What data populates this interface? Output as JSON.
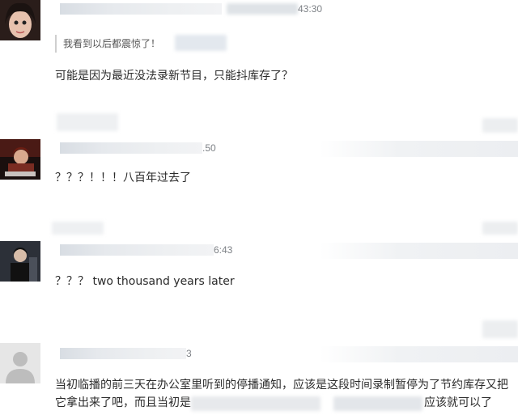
{
  "comments": [
    {
      "time_fragment": "43:30",
      "reply_quote": "我看到以后都震惊了！",
      "text": "可能是因为最近没法录新节目，只能抖库存了？"
    },
    {
      "time_fragment": ".50",
      "text": "？？？！！！八百年过去了"
    },
    {
      "time_fragment": "6:43",
      "text": "？？？ two thousand years later"
    },
    {
      "time_fragment": "3",
      "text_line1": "当初临播的前三天在办公室里听到的停播通知，应该是这段时间录制暂停为了节约库存又把",
      "text_line2_a": "它拿出来了吧，而且当初是",
      "text_line2_b": "应该就可以了"
    }
  ],
  "colors": {
    "meta_bar": "#d8dde3",
    "text": "#2b2b2b",
    "timestamp": "#7d8186"
  },
  "icons": [
    "user-avatar-photo",
    "user-avatar-photo",
    "user-avatar-photo",
    "default-avatar-icon"
  ]
}
